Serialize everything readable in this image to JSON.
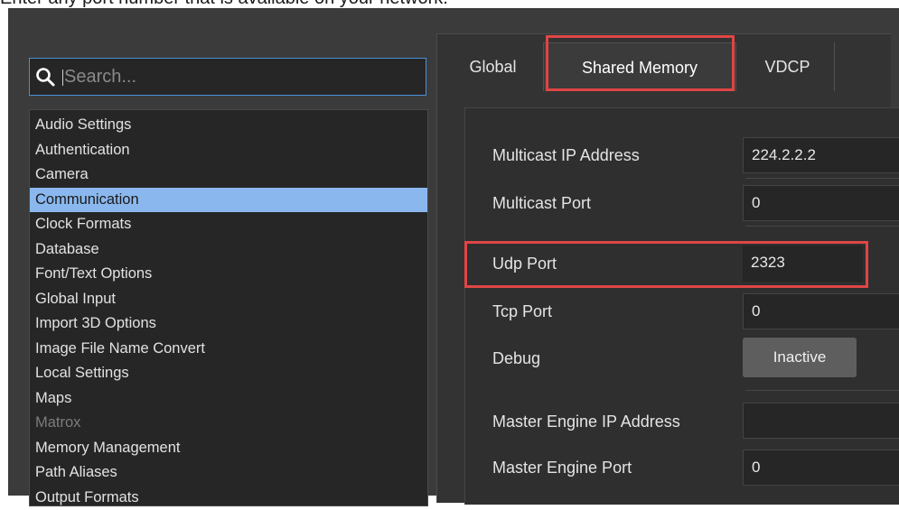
{
  "caption": "Enter any port number that is available on your network.",
  "search": {
    "placeholder": "Search..."
  },
  "sidebar": {
    "items": [
      {
        "label": "Audio Settings"
      },
      {
        "label": "Authentication"
      },
      {
        "label": "Camera"
      },
      {
        "label": "Communication",
        "selected": true
      },
      {
        "label": "Clock Formats"
      },
      {
        "label": "Database"
      },
      {
        "label": "Font/Text Options"
      },
      {
        "label": "Global Input"
      },
      {
        "label": "Import 3D Options"
      },
      {
        "label": "Image File Name Convert"
      },
      {
        "label": "Local Settings"
      },
      {
        "label": "Maps"
      },
      {
        "label": "Matrox",
        "disabled": true
      },
      {
        "label": "Memory Management"
      },
      {
        "label": "Path Aliases"
      },
      {
        "label": "Output Formats"
      }
    ]
  },
  "tabs": [
    {
      "label": "Global"
    },
    {
      "label": "Shared Memory",
      "active": true
    },
    {
      "label": "VDCP"
    }
  ],
  "form": {
    "multicast_ip": {
      "label": "Multicast IP Address",
      "value": "224.2.2.2"
    },
    "multicast_port": {
      "label": "Multicast Port",
      "value": "0"
    },
    "udp_port": {
      "label": "Udp Port",
      "value": "2323"
    },
    "tcp_port": {
      "label": "Tcp Port",
      "value": "0"
    },
    "debug": {
      "label": "Debug",
      "button": "Inactive"
    },
    "master_ip": {
      "label": "Master Engine IP Address",
      "value": ""
    },
    "master_port": {
      "label": "Master Engine Port",
      "value": "0"
    }
  },
  "colors": {
    "selection": "#8ab8ee",
    "highlight": "#e04545",
    "focus": "#4a90d9"
  }
}
